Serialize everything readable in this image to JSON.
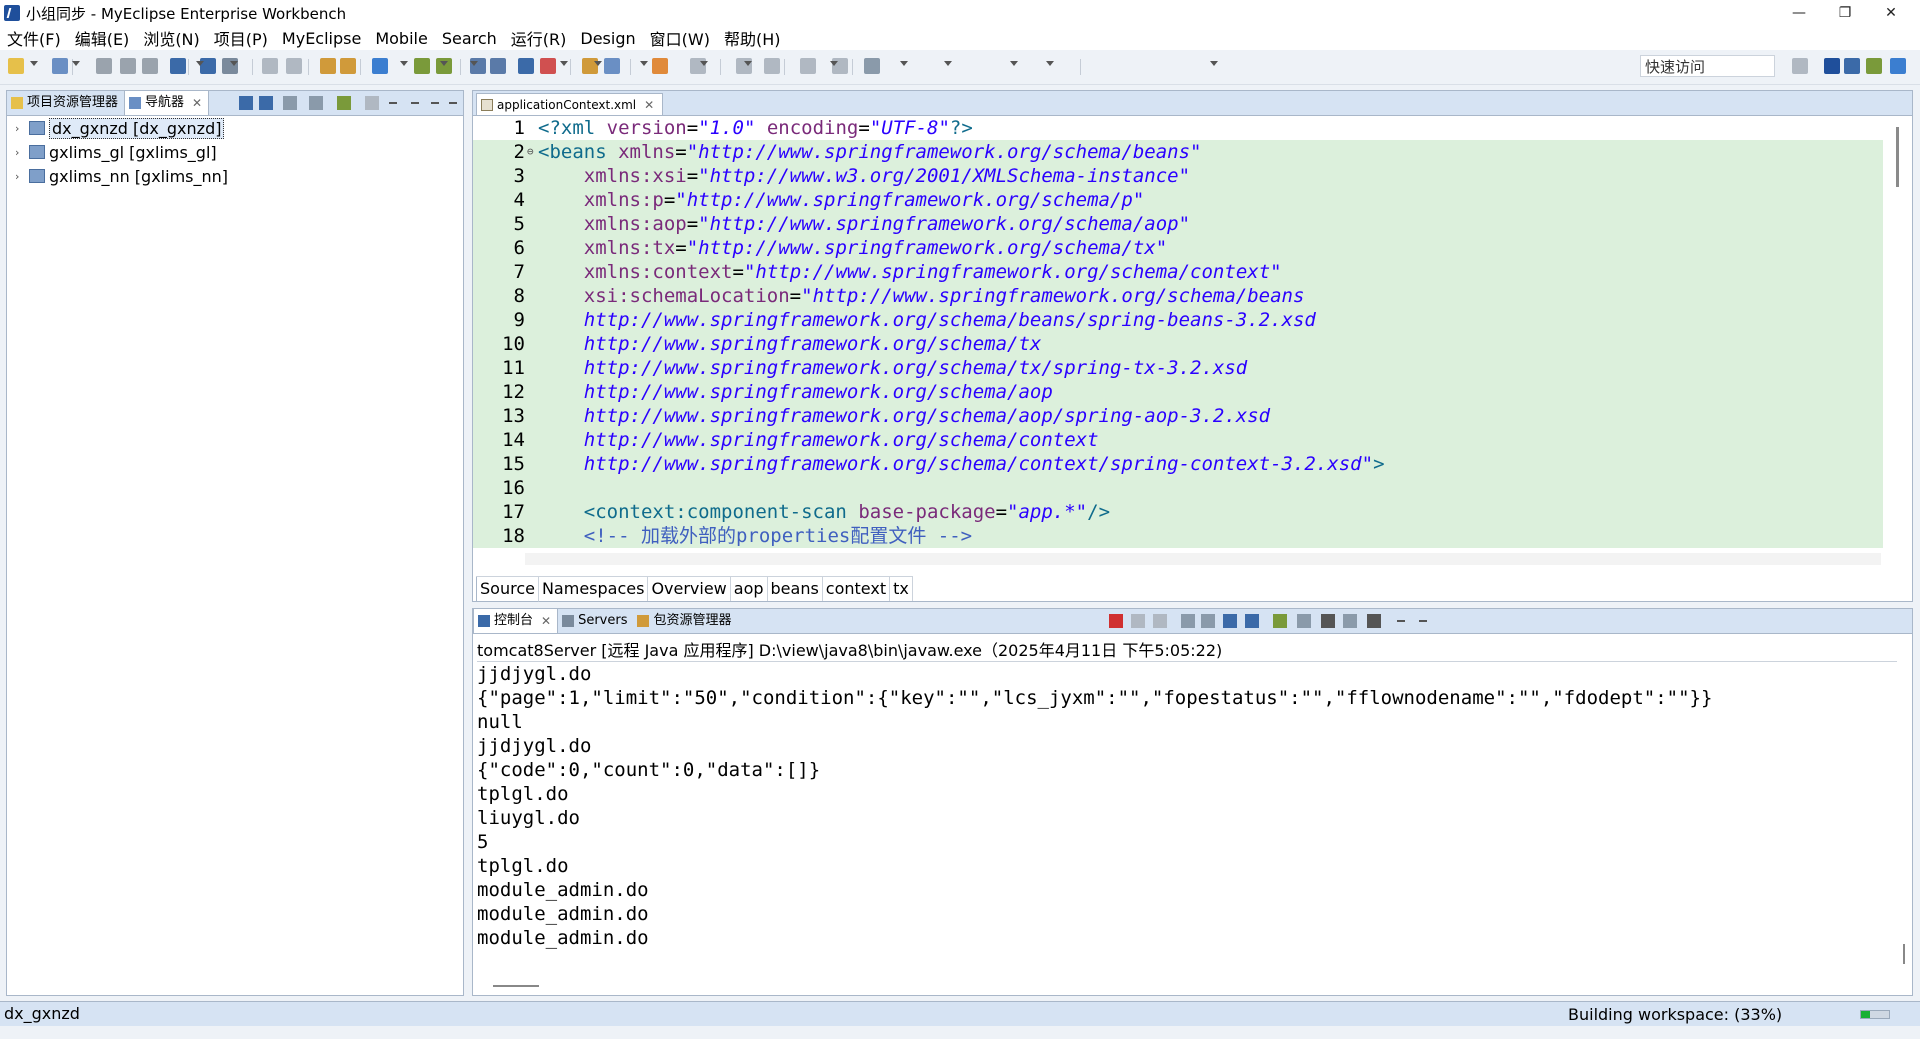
{
  "window": {
    "title": "小组同步 - MyEclipse Enterprise Workbench",
    "controls": {
      "minimize": "—",
      "maximize": "❐",
      "close": "✕"
    }
  },
  "menubar": {
    "items": [
      "文件(F)",
      "编辑(E)",
      "浏览(N)",
      "项目(P)",
      "MyEclipse",
      "Mobile",
      "Search",
      "运行(R)",
      "Design",
      "窗口(W)",
      "帮助(H)"
    ]
  },
  "toolbar": {
    "quick_access": "快速访问"
  },
  "left_panel": {
    "tabs": [
      {
        "label": "项目资源管理器",
        "icon": "folder-icon"
      },
      {
        "label": "导航器",
        "icon": "navigator-icon",
        "close": "✕"
      }
    ],
    "tree": [
      {
        "label": "dx_gxnzd [dx_gxnzd]",
        "arrow": "›",
        "selected": true
      },
      {
        "label": "gxlims_gl [gxlims_gl]",
        "arrow": "›",
        "selected": false
      },
      {
        "label": "gxlims_nn [gxlims_nn]",
        "arrow": "›",
        "selected": false
      }
    ]
  },
  "editor": {
    "tab": {
      "label": "applicationContext.xml",
      "close": "✕"
    },
    "lines": [
      {
        "num": "1",
        "fold": "",
        "parts": [
          [
            "tag",
            "<?"
          ],
          [
            "tag",
            "xml "
          ],
          [
            "attr",
            "version"
          ],
          [
            "plain",
            "="
          ],
          [
            "val",
            "\"1.0\""
          ],
          [
            "plain",
            " "
          ],
          [
            "attr",
            "encoding"
          ],
          [
            "plain",
            "="
          ],
          [
            "val",
            "\"UTF-8\""
          ],
          [
            "tag",
            "?>"
          ]
        ]
      },
      {
        "num": "2",
        "fold": "⊖",
        "parts": [
          [
            "tag",
            "<beans "
          ],
          [
            "attr",
            "xmlns"
          ],
          [
            "plain",
            "="
          ],
          [
            "val",
            "\"http://www.springframework.org/schema/beans\""
          ]
        ]
      },
      {
        "num": "3",
        "fold": "",
        "parts": [
          [
            "plain",
            "    "
          ],
          [
            "attr",
            "xmlns:xsi"
          ],
          [
            "plain",
            "="
          ],
          [
            "val",
            "\"http://www.w3.org/2001/XMLSchema-instance\""
          ]
        ]
      },
      {
        "num": "4",
        "fold": "",
        "parts": [
          [
            "plain",
            "    "
          ],
          [
            "attr",
            "xmlns:p"
          ],
          [
            "plain",
            "="
          ],
          [
            "val",
            "\"http://www.springframework.org/schema/p\""
          ]
        ]
      },
      {
        "num": "5",
        "fold": "",
        "parts": [
          [
            "plain",
            "    "
          ],
          [
            "attr",
            "xmlns:aop"
          ],
          [
            "plain",
            "="
          ],
          [
            "val",
            "\"http://www.springframework.org/schema/aop\""
          ]
        ]
      },
      {
        "num": "6",
        "fold": "",
        "parts": [
          [
            "plain",
            "    "
          ],
          [
            "attr",
            "xmlns:tx"
          ],
          [
            "plain",
            "="
          ],
          [
            "val",
            "\"http://www.springframework.org/schema/tx\""
          ]
        ]
      },
      {
        "num": "7",
        "fold": "",
        "parts": [
          [
            "plain",
            "    "
          ],
          [
            "attr",
            "xmlns:context"
          ],
          [
            "plain",
            "="
          ],
          [
            "val",
            "\"http://www.springframework.org/schema/context\""
          ]
        ]
      },
      {
        "num": "8",
        "fold": "",
        "parts": [
          [
            "plain",
            "    "
          ],
          [
            "attr",
            "xsi:schemaLocation"
          ],
          [
            "plain",
            "="
          ],
          [
            "val",
            "\"http://www.springframework.org/schema/beans"
          ]
        ]
      },
      {
        "num": "9",
        "fold": "",
        "parts": [
          [
            "plain",
            "    "
          ],
          [
            "val",
            "http://www.springframework.org/schema/beans/spring-beans-3.2.xsd"
          ]
        ]
      },
      {
        "num": "10",
        "fold": "",
        "parts": [
          [
            "plain",
            "    "
          ],
          [
            "val",
            "http://www.springframework.org/schema/tx"
          ]
        ]
      },
      {
        "num": "11",
        "fold": "",
        "parts": [
          [
            "plain",
            "    "
          ],
          [
            "val",
            "http://www.springframework.org/schema/tx/spring-tx-3.2.xsd"
          ]
        ]
      },
      {
        "num": "12",
        "fold": "",
        "parts": [
          [
            "plain",
            "    "
          ],
          [
            "val",
            "http://www.springframework.org/schema/aop"
          ]
        ]
      },
      {
        "num": "13",
        "fold": "",
        "parts": [
          [
            "plain",
            "    "
          ],
          [
            "val",
            "http://www.springframework.org/schema/aop/spring-aop-3.2.xsd"
          ]
        ]
      },
      {
        "num": "14",
        "fold": "",
        "parts": [
          [
            "plain",
            "    "
          ],
          [
            "val",
            "http://www.springframework.org/schema/context"
          ]
        ]
      },
      {
        "num": "15",
        "fold": "",
        "parts": [
          [
            "plain",
            "    "
          ],
          [
            "val",
            "http://www.springframework.org/schema/context/spring-context-3.2.xsd\""
          ],
          [
            "tag",
            ">"
          ]
        ]
      },
      {
        "num": "16",
        "fold": "",
        "parts": []
      },
      {
        "num": "17",
        "fold": "",
        "parts": [
          [
            "plain",
            "    "
          ],
          [
            "tag",
            "<context:component-scan "
          ],
          [
            "attr",
            "base-package"
          ],
          [
            "plain",
            "="
          ],
          [
            "val",
            "\"app.*\""
          ],
          [
            "tag",
            "/>"
          ]
        ]
      },
      {
        "num": "18",
        "fold": "",
        "parts": [
          [
            "plain",
            "    "
          ],
          [
            "cmt",
            "<!-- 加载外部的properties配置文件 -->"
          ]
        ]
      }
    ],
    "bottom_tabs": [
      "Source",
      "Namespaces",
      "Overview",
      "aop",
      "beans",
      "context",
      "tx"
    ]
  },
  "console": {
    "tabs": [
      {
        "label": "控制台",
        "icon": "console-icon",
        "close": "✕"
      },
      {
        "label": "Servers",
        "icon": "servers-icon"
      },
      {
        "label": "包资源管理器",
        "icon": "package-explorer-icon"
      }
    ],
    "header": "tomcat8Server [远程 Java 应用程序] D:\\view\\java8\\bin\\javaw.exe（2025年4月11日 下午5:05:22)",
    "output": [
      "jjdjygl.do",
      "{\"page\":1,\"limit\":\"50\",\"condition\":{\"key\":\"\",\"lcs_jyxm\":\"\",\"fopestatus\":\"\",\"fflownodename\":\"\",\"fdodept\":\"\"}}",
      "null",
      "jjdjygl.do",
      "{\"code\":0,\"count\":0,\"data\":[]}",
      "tplgl.do",
      "liuygl.do",
      "5",
      "tplgl.do",
      "module_admin.do",
      "module_admin.do",
      "module_admin.do"
    ]
  },
  "statusbar": {
    "left": "dx_gxnzd",
    "right": "Building workspace:   (33%)",
    "progress": 0.33
  },
  "colors": {
    "tab_bg": "#d6e3f3",
    "highlight_line": "#dcf0dc",
    "xml_value": "#2a00ff",
    "xml_attr": "#7a2a7a",
    "xml_tag": "#0f6b8c",
    "progress_green": "#18b034"
  }
}
